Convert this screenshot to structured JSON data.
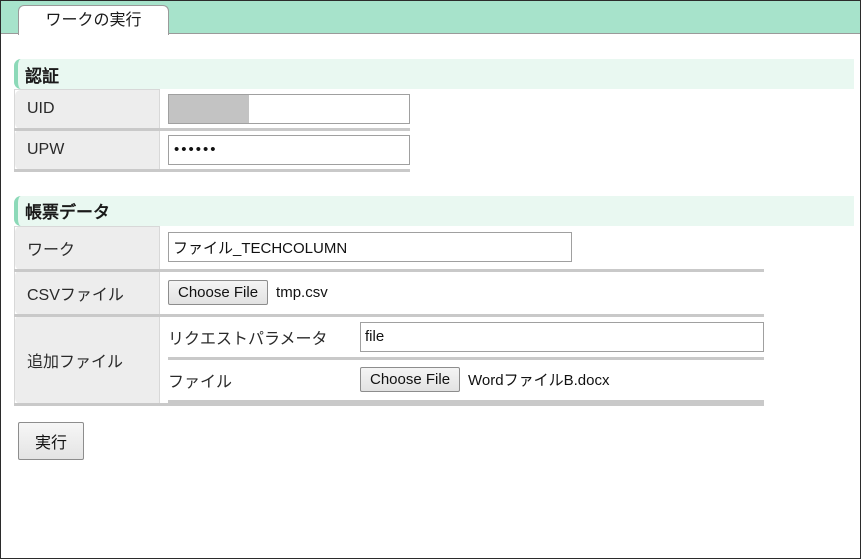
{
  "window": {
    "tab": {
      "label": "ワークの実行"
    }
  },
  "sections": [
    {
      "id": "auth",
      "title": "認証",
      "rows": [
        {
          "label": "UID",
          "type": "text",
          "value": "",
          "redacted": true
        },
        {
          "label": "UPW",
          "type": "password",
          "value": "••••••"
        }
      ]
    },
    {
      "id": "form_data",
      "title": "帳票データ",
      "rows": [
        {
          "label": "ワーク",
          "type": "text",
          "value": "ファイル_TECHCOLUMN"
        },
        {
          "label": "CSVファイル",
          "type": "file",
          "button_label": "Choose File",
          "file_name": "tmp.csv"
        },
        {
          "label": "追加ファイル",
          "type": "nested",
          "nested_rows": [
            {
              "label": "リクエストパラメータ",
              "type": "text",
              "value": "file"
            },
            {
              "label": "ファイル",
              "type": "file",
              "button_label": "Choose File",
              "file_name": "WordファイルB.docx"
            }
          ]
        }
      ]
    }
  ],
  "actions": {
    "submit_label": "実行"
  },
  "colors": {
    "tab_bar_green": "#a7e3cb",
    "section_header_bg": "#e9f8f1",
    "section_accent": "#8cd9b8",
    "label_cell_bg": "#ededed",
    "row_separator": "#c9c9c9",
    "redaction_gray": "#c3c3c3"
  }
}
